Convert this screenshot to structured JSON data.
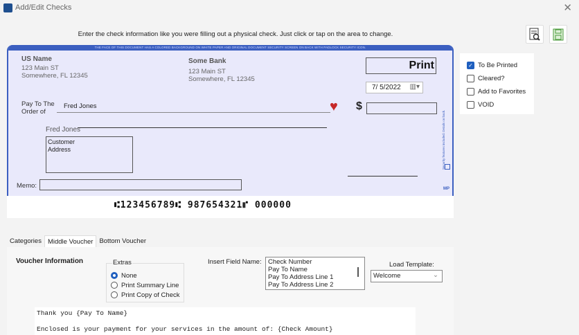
{
  "window": {
    "title": "Add/Edit Checks",
    "close": "✕"
  },
  "instruction": "Enter the check information like you were filling out a physical check. Just click or tap on the area to change.",
  "check": {
    "banner": "THE FACE OF THIS DOCUMENT HAS A COLORED BACKGROUND ON WHITE PAPER AND ORIGINAL DOCUMENT SECURITY SCREEN ON BACK WITH PADLOCK SECURITY ICON.",
    "payer": {
      "name": "US Name",
      "line1": "123 Main ST",
      "line2": "Somewhere, FL 12345"
    },
    "bank": {
      "name": "Some Bank",
      "line1": "123 Main ST",
      "line2": "Somewhere, FL 12345"
    },
    "number_box": "Print",
    "date": "7/ 5/2022",
    "pay_to_label_1": "Pay To The",
    "pay_to_label_2": "Order of",
    "payee": "Fred Jones",
    "dollar": "$",
    "amount": "",
    "address_name": "Fred Jones",
    "address": "Customer\nAddress",
    "memo_label": "Memo:",
    "memo": "",
    "security_text": "Security features included. Details on back.",
    "mp": "MP",
    "micr": "⑆123456789⑆  987654321⑈ 000000"
  },
  "options": [
    {
      "label": "To Be Printed",
      "checked": true
    },
    {
      "label": "Cleared?",
      "checked": false
    },
    {
      "label": "Add to Favorites",
      "checked": false
    },
    {
      "label": "VOID",
      "checked": false
    }
  ],
  "tabs": [
    "Categories",
    "Middle Voucher",
    "Bottom Voucher"
  ],
  "voucher": {
    "heading": "Voucher Information",
    "extras_label": "Extras",
    "extras": [
      "None",
      "Print Summary Line",
      "Print Copy of Check"
    ],
    "insert_label": "Insert Field Name:",
    "fields": [
      "Check Number",
      "Pay To Name",
      "Pay To Address Line 1",
      "Pay To Address Line 2"
    ],
    "template_label": "Load Template:",
    "template": "Welcome",
    "text_line1": "Thank you {Pay To Name}",
    "text_line2": "Enclosed is your payment for your services in the amount of: {Check Amount}"
  }
}
